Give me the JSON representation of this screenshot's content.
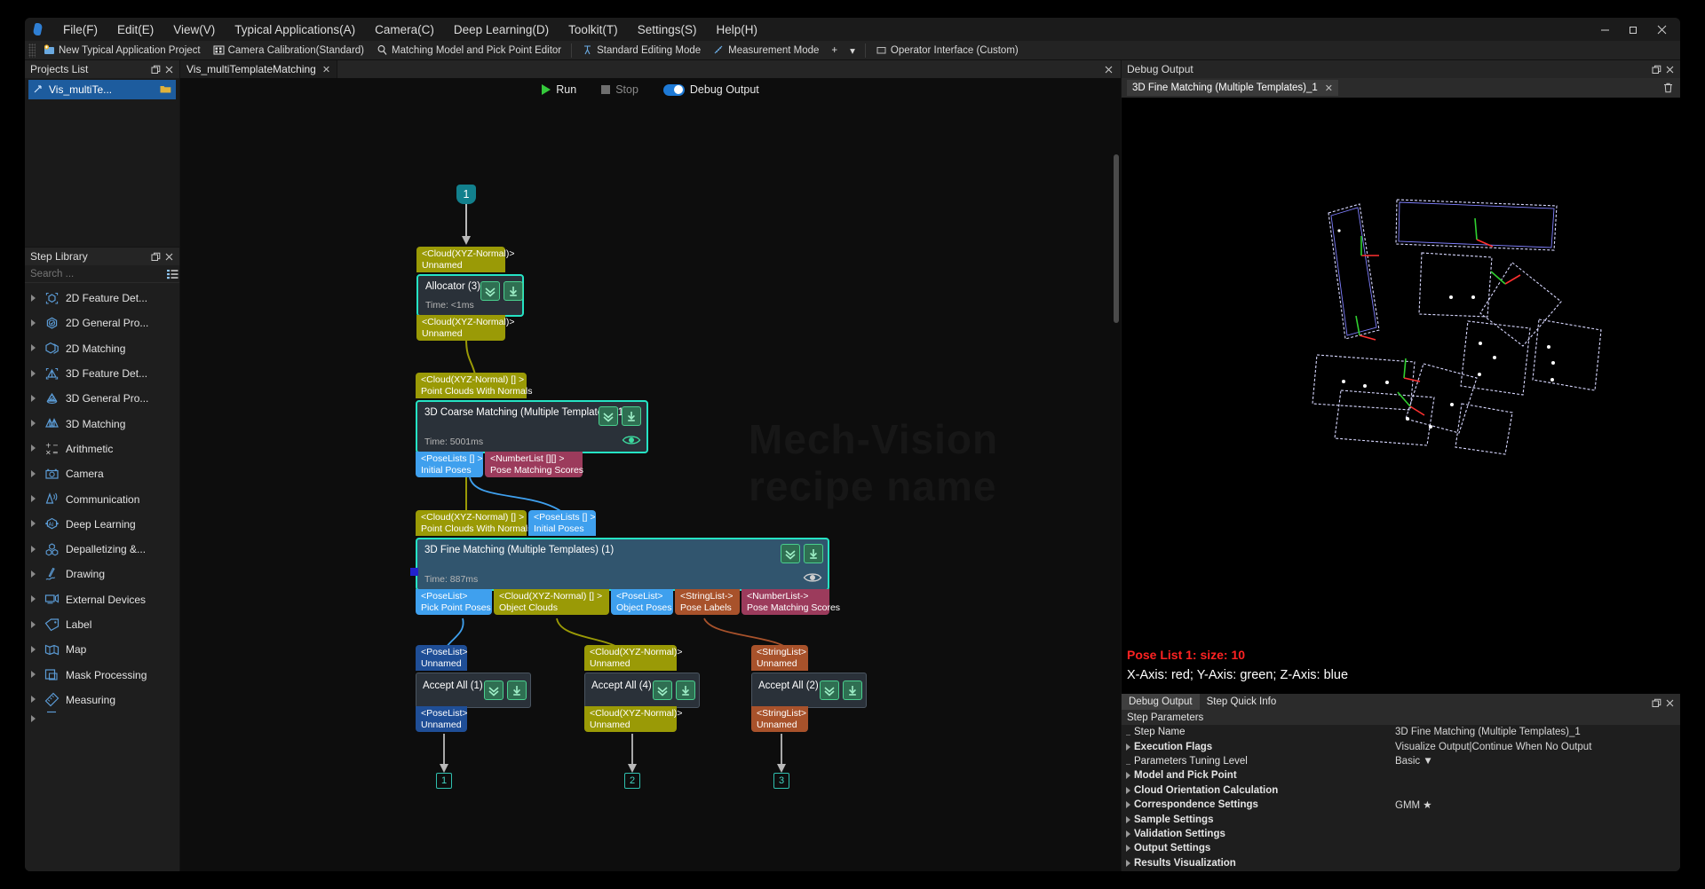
{
  "menu": {
    "items": [
      "File(F)",
      "Edit(E)",
      "View(V)",
      "Typical Applications(A)",
      "Camera(C)",
      "Deep Learning(D)",
      "Toolkit(T)",
      "Settings(S)",
      "Help(H)"
    ],
    "window_buttons": [
      "minimize",
      "restore",
      "close"
    ]
  },
  "toolbar": {
    "items": [
      {
        "label": "New Typical Application Project",
        "icon": "new-project-icon"
      },
      {
        "label": "Camera Calibration(Standard)",
        "icon": "calibration-grid-icon"
      },
      {
        "label": "Matching Model and Pick Point Editor",
        "icon": "magnifier-icon"
      },
      {
        "label": "Standard Editing Mode",
        "icon": "edit-mode-icon"
      },
      {
        "label": "Measurement Mode",
        "icon": "measure-icon"
      },
      {
        "label": "Operator Interface (Custom)",
        "icon": "operator-ui-icon"
      }
    ],
    "extra": [
      "+",
      "▾"
    ]
  },
  "projects_panel": {
    "title": "Projects List",
    "float_icon": "float-icon",
    "close_icon": "close-icon",
    "items": [
      {
        "label": "Vis_multiTe...",
        "icon": "project-icon",
        "trailing_icon": "folder-icon"
      }
    ]
  },
  "step_library": {
    "title": "Step Library",
    "float_icon": "float-icon",
    "close_icon": "close-icon",
    "search_placeholder": "Search ...",
    "filter_icon": "filter-list-icon",
    "items": [
      {
        "label": "2D Feature Det...",
        "icon": "2d-feature-detection-icon"
      },
      {
        "label": "2D General Pro...",
        "icon": "2d-general-processing-icon"
      },
      {
        "label": "2D Matching",
        "icon": "2d-matching-icon"
      },
      {
        "label": "3D Feature Det...",
        "icon": "3d-feature-detection-icon"
      },
      {
        "label": "3D General Pro...",
        "icon": "3d-general-processing-icon"
      },
      {
        "label": "3D Matching",
        "icon": "3d-matching-icon"
      },
      {
        "label": "Arithmetic",
        "icon": "arithmetic-icon"
      },
      {
        "label": "Camera",
        "icon": "camera-icon"
      },
      {
        "label": "Communication",
        "icon": "communication-icon"
      },
      {
        "label": "Deep Learning",
        "icon": "deep-learning-ai-icon"
      },
      {
        "label": "Depalletizing &...",
        "icon": "depalletizing-icon"
      },
      {
        "label": "Drawing",
        "icon": "drawing-pen-icon"
      },
      {
        "label": "External Devices",
        "icon": "external-devices-icon"
      },
      {
        "label": "Label",
        "icon": "label-icon"
      },
      {
        "label": "Map",
        "icon": "map-icon"
      },
      {
        "label": "Mask Processing",
        "icon": "mask-processing-icon"
      },
      {
        "label": "Measuring",
        "icon": "measuring-icon"
      }
    ]
  },
  "editor": {
    "tab": {
      "label": "Vis_multiTemplateMatching",
      "close_icon": "close-icon"
    },
    "close_all_icon": "close-icon",
    "run_label": "Run",
    "stop_label": "Stop",
    "debug_output_label": "Debug Output",
    "debug_output_on": true,
    "watermark": "Mech-Vision\nrecipe name"
  },
  "graph": {
    "badges_top": [
      {
        "text": "1"
      }
    ],
    "badges_bottom": [
      {
        "text": "1"
      },
      {
        "text": "2"
      },
      {
        "text": "3"
      }
    ],
    "nodes": [
      {
        "name": "Allocator (3)",
        "time": "Time: <1ms",
        "inputs": [
          {
            "type": "<Cloud(XYZ-Normal)>",
            "name": "Unnamed",
            "color": "olive"
          }
        ],
        "outputs": [
          {
            "type": "<Cloud(XYZ-Normal)>",
            "name": "Unnamed",
            "color": "olive"
          }
        ]
      },
      {
        "name": "3D Coarse Matching (Multiple Templates) (1)",
        "time": "Time: 5001ms",
        "inputs": [
          {
            "type": "<Cloud(XYZ-Normal) [] >",
            "name": "Point Clouds With Normals",
            "color": "olive"
          }
        ],
        "outputs": [
          {
            "type": "<PoseLists [] >",
            "name": "Initial Poses",
            "color": "blue"
          },
          {
            "type": "<NumberList [][] >",
            "name": "Pose Matching Scores",
            "color": "maroon"
          }
        ]
      },
      {
        "name": "3D Fine Matching (Multiple Templates) (1)",
        "time": "Time: 887ms",
        "inputs": [
          {
            "type": "<Cloud(XYZ-Normal) [] >",
            "name": "Point Clouds With Normals",
            "color": "olive"
          },
          {
            "type": "<PoseLists [] >",
            "name": "Initial Poses",
            "color": "blue"
          }
        ],
        "outputs": [
          {
            "type": "<PoseList>",
            "name": "Pick Point Poses",
            "color": "blue"
          },
          {
            "type": "<Cloud(XYZ-Normal) [] >",
            "name": "Object Clouds",
            "color": "olive"
          },
          {
            "type": "<PoseList>",
            "name": "Object Poses",
            "color": "blue"
          },
          {
            "type": "<StringList->",
            "name": "Pose Labels",
            "color": "brown"
          },
          {
            "type": "<NumberList->",
            "name": "Pose Matching Scores",
            "color": "maroon"
          }
        ]
      },
      {
        "name": "Accept All (1)",
        "inputs": [
          {
            "type": "<PoseList>",
            "name": "Unnamed",
            "color": "blued"
          }
        ],
        "outputs": [
          {
            "type": "<PoseList>",
            "name": "Unnamed",
            "color": "blued"
          }
        ]
      },
      {
        "name": "Accept All (4)",
        "inputs": [
          {
            "type": "<Cloud(XYZ-Normal)>",
            "name": "Unnamed",
            "color": "olive"
          }
        ],
        "outputs": [
          {
            "type": "<Cloud(XYZ-Normal)>",
            "name": "Unnamed",
            "color": "olive"
          }
        ]
      },
      {
        "name": "Accept All (2)",
        "inputs": [
          {
            "type": "<StringList>",
            "name": "Unnamed",
            "color": "brown"
          }
        ],
        "outputs": [
          {
            "type": "<StringList>",
            "name": "Unnamed",
            "color": "brown"
          }
        ]
      }
    ]
  },
  "debug_panel": {
    "title": "Debug Output",
    "float_icon": "float-icon",
    "close_icon": "close-icon",
    "trash_icon": "trash-icon",
    "tab": {
      "label": "3D Fine Matching (Multiple Templates)_1",
      "close_icon": "close-icon"
    },
    "viewport_text_1": "Pose List 1: size: 10",
    "viewport_text_2": "X-Axis: red; Y-Axis: green; Z-Axis: blue"
  },
  "params_panel": {
    "tabs": [
      {
        "label": "Debug Output",
        "active": true
      },
      {
        "label": "Step Quick Info",
        "active": false
      }
    ],
    "float_icon": "float-icon",
    "close_icon": "close-icon",
    "section_title": "Step Parameters",
    "rows": [
      {
        "label": "Step Name",
        "value": "3D Fine Matching (Multiple Templates)_1",
        "expandable": false,
        "bold": false
      },
      {
        "label": "Execution Flags",
        "value": "Visualize Output|Continue When No Output",
        "expandable": true,
        "bold": true
      },
      {
        "label": "Parameters Tuning Level",
        "value": "Basic  ▼",
        "expandable": false,
        "bold": false
      },
      {
        "label": "Model and Pick Point",
        "value": "",
        "expandable": true,
        "bold": true
      },
      {
        "label": "Cloud Orientation Calculation",
        "value": "",
        "expandable": true,
        "bold": true
      },
      {
        "label": "Correspondence Settings",
        "value": "GMM ★",
        "expandable": true,
        "bold": true
      },
      {
        "label": "Sample Settings",
        "value": "",
        "expandable": true,
        "bold": true
      },
      {
        "label": "Validation Settings",
        "value": "",
        "expandable": true,
        "bold": true
      },
      {
        "label": "Output Settings",
        "value": "",
        "expandable": true,
        "bold": true
      },
      {
        "label": "Results Visualization",
        "value": "",
        "expandable": true,
        "bold": true
      }
    ]
  },
  "colors": {
    "accent_teal": "#25e3c4",
    "selection_blue": "#1d5c9e",
    "olive": "#9a9a06",
    "blue": "#3fa0ee",
    "maroon": "#9c3b5c",
    "brown": "#a8522b",
    "axis_red": "#ff2222"
  }
}
